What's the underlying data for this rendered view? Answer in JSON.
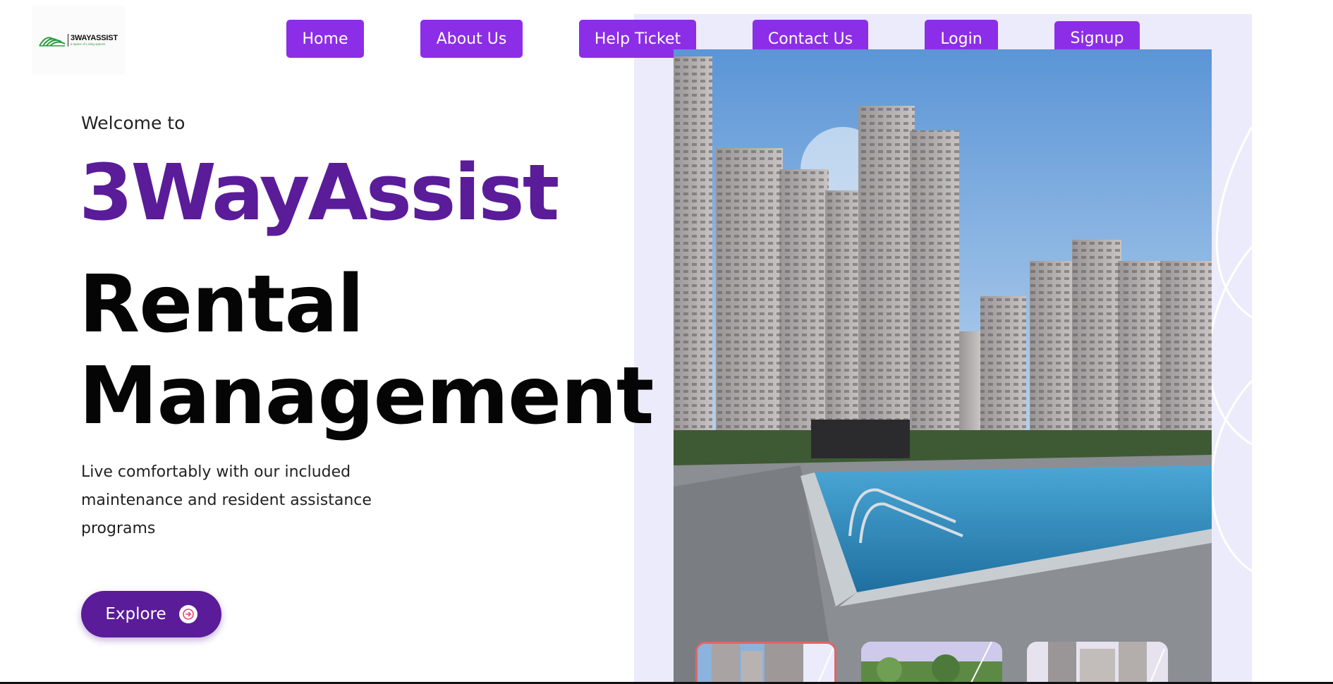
{
  "logo": {
    "title": "3WAYASSIST",
    "tagline": "a space of Living spaces",
    "icon": "logo-mark"
  },
  "nav": {
    "items": [
      {
        "label": "Home"
      },
      {
        "label": "About Us"
      },
      {
        "label": "Help Ticket"
      },
      {
        "label": "Contact Us"
      },
      {
        "label": "Login"
      },
      {
        "label": "Signup"
      }
    ]
  },
  "hero": {
    "welcome": "Welcome to",
    "brand": "3WayAssist",
    "headline_line1": "Rental",
    "headline_line2": "Management",
    "description": "Live comfortably with our included maintenance and resident assistance programs",
    "explore_label": "Explore",
    "explore_icon": "arrow-right-circle-icon"
  },
  "colors": {
    "nav_button": "#8c2ee8",
    "brand_purple": "#5a1c99",
    "panel_bg": "#ecebfb",
    "active_thumb_border": "#e06666"
  },
  "gallery": {
    "main_image": "apartment towers and swimming pool",
    "thumbnails": [
      {
        "subject": "apartment towers",
        "active": true
      },
      {
        "subject": "green trees",
        "active": false
      },
      {
        "subject": "apartment towers",
        "active": false
      }
    ]
  }
}
